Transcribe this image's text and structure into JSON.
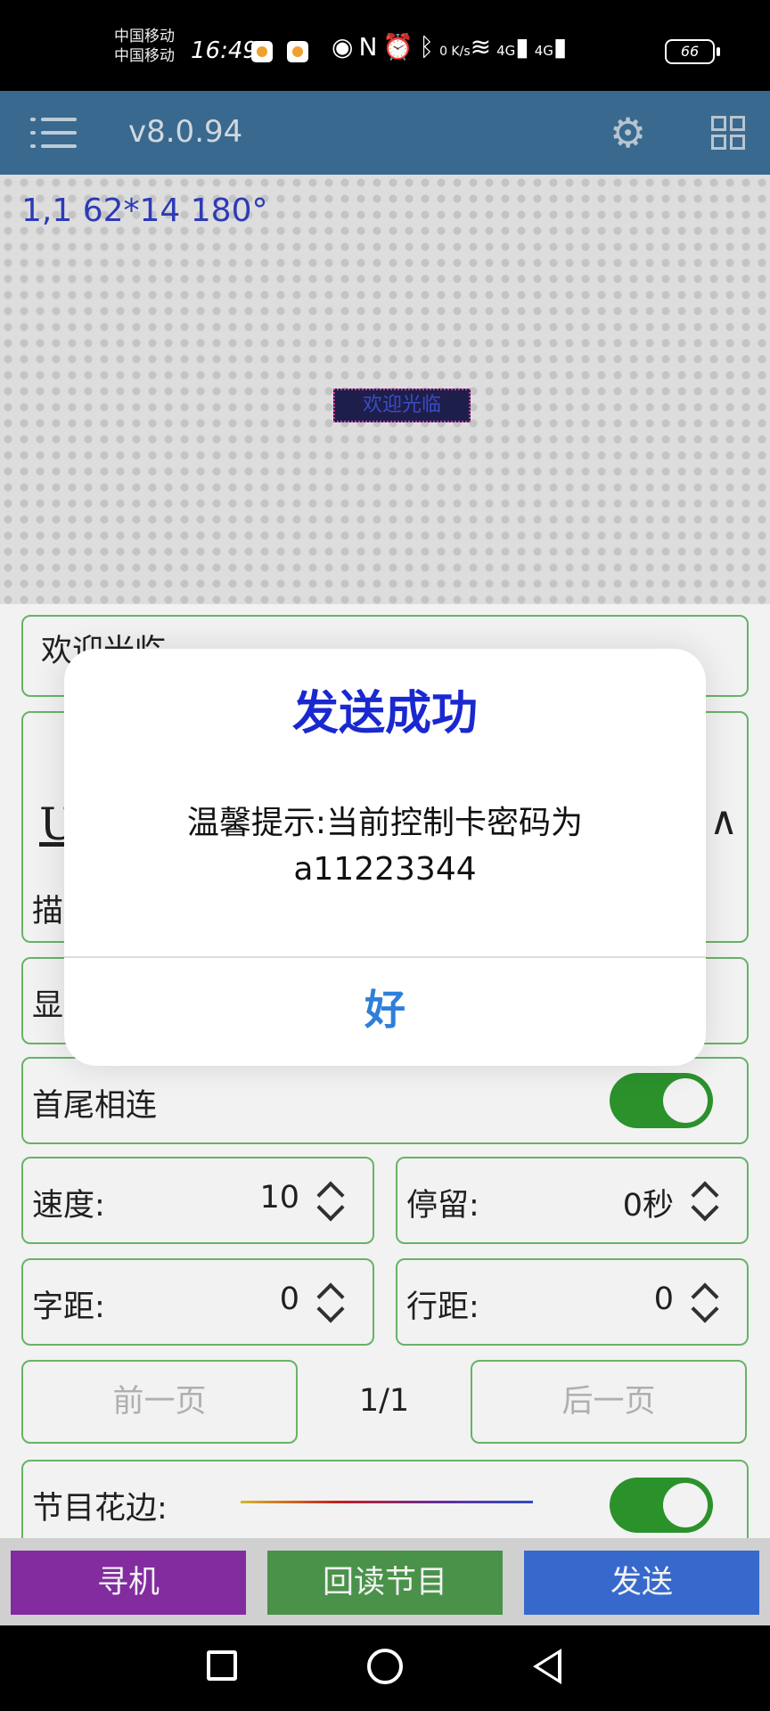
{
  "status_bar": {
    "carrier_line1": "中国移动",
    "carrier_line2": "中国移动",
    "time": "16:49",
    "speed": "0 K/s",
    "network1": "4G",
    "network2": "4G",
    "battery": "66"
  },
  "app_bar": {
    "version": "v8.0.94",
    "menu_icon": "hamburger-icon",
    "settings_icon": "gear-icon",
    "grid_icon": "grid-icon"
  },
  "preview": {
    "info": "1,1 62*14  180°",
    "led_text": "欢迎光临"
  },
  "form": {
    "text_value": "欢迎光临",
    "partial_label_1": "描",
    "partial_label_2": "显",
    "partial_u": "U",
    "loop_label": "首尾相连",
    "loop_on": true,
    "speed_label": "速度:",
    "speed_value": "10",
    "stay_label": "停留:",
    "stay_value": "0秒",
    "char_spacing_label": "字距:",
    "char_spacing_value": "0",
    "line_spacing_label": "行距:",
    "line_spacing_value": "0",
    "prev_page": "前一页",
    "page_indicator": "1/1",
    "next_page": "后一页",
    "border_label": "节目花边:",
    "border_on": true
  },
  "bottom_buttons": {
    "search": "寻机",
    "readback": "回读节目",
    "send": "发送"
  },
  "colors": {
    "app_bar": "#3d6f96",
    "search_button": "#8a2fa8",
    "readback_button": "#4f9a4f",
    "send_button": "#3a6fd8",
    "toggle_on": "#2e9a2e",
    "dialog_title": "#1a28d0"
  },
  "dialog": {
    "title": "发送成功",
    "message_line1": "温馨提示:当前控制卡密码为",
    "message_line2": "a11223344",
    "ok": "好"
  }
}
